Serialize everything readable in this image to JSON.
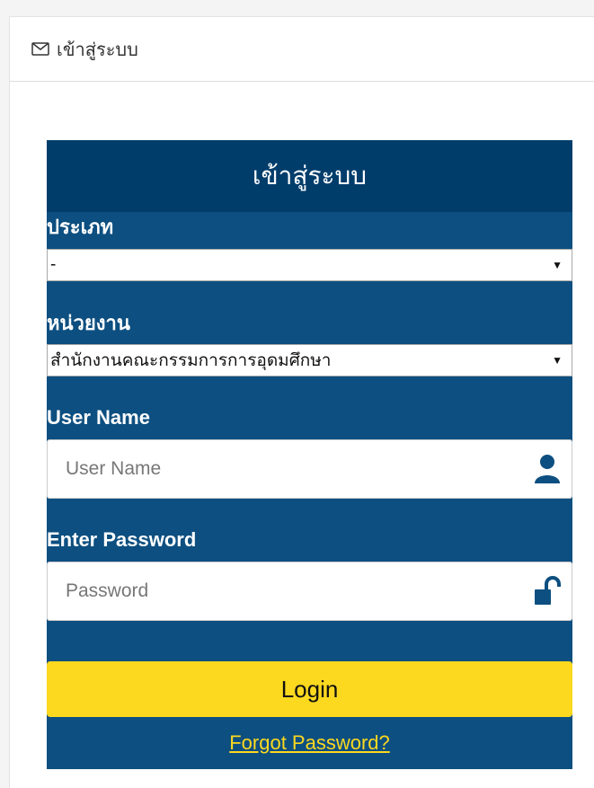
{
  "panel": {
    "title": "เข้าสู่ระบบ",
    "title_icon": "envelope-icon"
  },
  "login": {
    "header": "เข้าสู่ระบบ",
    "type_label": "ประเภท",
    "type_value": "-",
    "agency_label": "หน่วยงาน",
    "agency_value": "สำนักงานคณะกรรมการการอุดมศึกษา",
    "username_label": "User Name",
    "username_placeholder": "User Name",
    "username_icon": "user-icon",
    "password_label": "Enter Password",
    "password_placeholder": "Password",
    "password_icon": "unlock-icon",
    "login_button": "Login",
    "forgot_link": "Forgot Password?"
  },
  "colors": {
    "header_bg": "#003d6b",
    "box_bg": "#0d4f80",
    "button_bg": "#fcd81f",
    "link_color": "#fcd81f"
  }
}
